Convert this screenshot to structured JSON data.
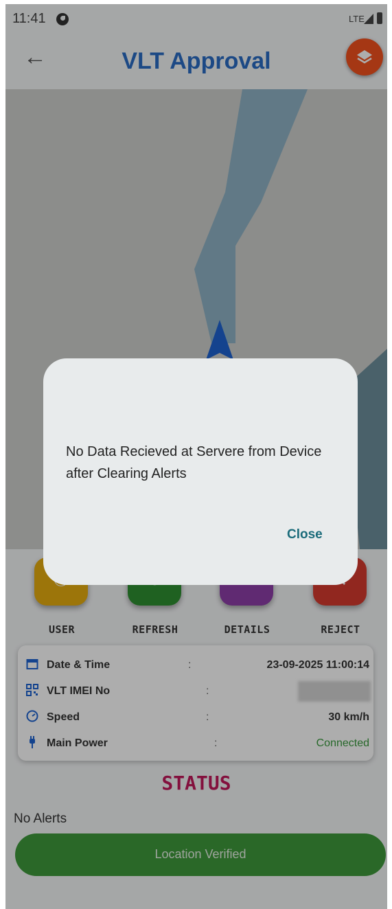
{
  "status_bar": {
    "time": "11:41",
    "network": "LTE"
  },
  "header": {
    "title": "VLT Approval",
    "back_icon": "arrow-left-icon",
    "layers_icon": "layers-icon",
    "layers_color": "#f4511e"
  },
  "actions": [
    {
      "label": "USER",
      "color": "#e6ad10",
      "icon": "user-icon"
    },
    {
      "label": "REFRESH",
      "color": "#2e8f32",
      "icon": "refresh-icon"
    },
    {
      "label": "DETAILS",
      "color": "#8e3fa8",
      "icon": "details-icon"
    },
    {
      "label": "REJECT",
      "color": "#d63a2f",
      "icon": "close-icon"
    }
  ],
  "info": {
    "date_time_label": "Date & Time",
    "date_time_value": "23-09-2025 11:00:14",
    "imei_label": "VLT IMEI No",
    "imei_value": "",
    "speed_label": "Speed",
    "speed_value": "30 km/h",
    "power_label": "Main Power",
    "power_value": "Connected",
    "separator": ":"
  },
  "status": {
    "title": "STATUS",
    "alerts": "No Alerts",
    "verify_button": "Location Verified"
  },
  "dialog": {
    "message": "No Data Recieved at Servere from Device after Clearing Alerts",
    "close_label": "Close"
  }
}
